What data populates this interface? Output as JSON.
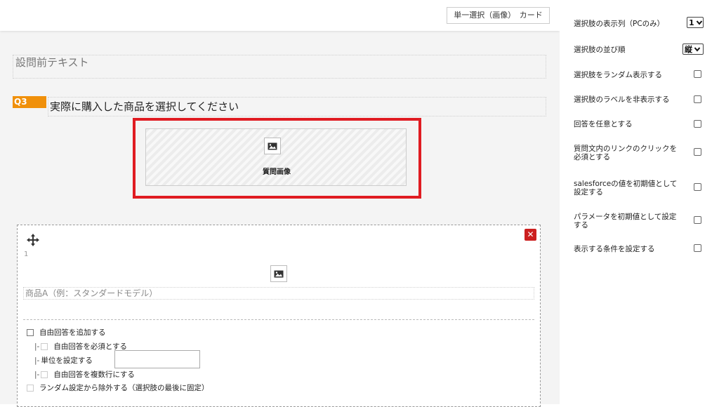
{
  "header": {
    "question_type": "単一選択（画像）　カード"
  },
  "question": {
    "pre_text": "設問前テキスト",
    "number": "Q3",
    "title": "実際に購入した商品を選択してください",
    "image_caption": "質問画像"
  },
  "choice": {
    "index": "1",
    "close": "✕",
    "text_placeholder": "商品A（例：スタンダードモデル）",
    "options": {
      "add_free_answer": "自由回答を追加する",
      "free_answer_required": "自由回答を必須とする",
      "unit": "単位を設定する",
      "multiline": "自由回答を複数行にする",
      "exclude_random": "ランダム設定から除外する（選択肢の最後に固定）"
    },
    "indent_mark": "|-"
  },
  "settings": {
    "columns_label": "選択肢の表示列（PCのみ）",
    "columns_value": "1",
    "order_label": "選択肢の並び順",
    "order_value": "縦",
    "random_label": "選択肢をランダム表示する",
    "hide_label": "選択肢のラベルを非表示する",
    "optional_label": "回答を任意とする",
    "link_required_label": "質問文内のリンクのクリックを必須とする",
    "salesforce_label": "salesforceの値を初期値として設定する",
    "param_label": "パラメータを初期値として設定する",
    "condition_label": "表示する条件を設定する"
  },
  "colors": {
    "accent": "#f0900a",
    "highlight": "#e01c22",
    "close": "#cc1f1f"
  }
}
